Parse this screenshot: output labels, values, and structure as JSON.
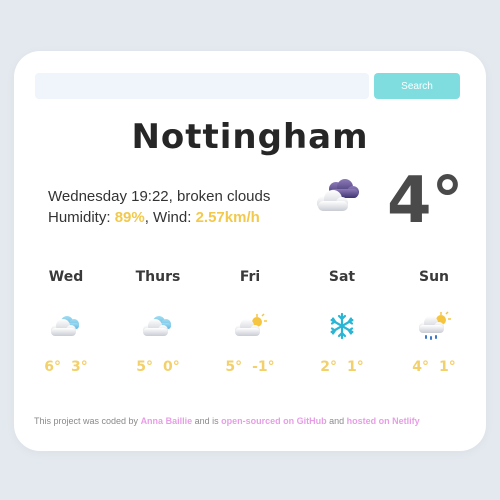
{
  "search": {
    "placeholder": "",
    "button_label": "Search"
  },
  "current": {
    "city": "Nottingham",
    "datetime_desc": "Wednesday 19:22, broken clouds",
    "humidity_label": "Humidity: ",
    "humidity_value": "89%",
    "wind_label": ", Wind: ",
    "wind_value": "2.57km/h",
    "temperature": "4°",
    "icon": "broken-clouds-night-icon"
  },
  "forecast": [
    {
      "day": "Wed",
      "high": "6°",
      "low": "3°",
      "icon": "cloud-icon"
    },
    {
      "day": "Thurs",
      "high": "5°",
      "low": "0°",
      "icon": "cloud-icon"
    },
    {
      "day": "Fri",
      "high": "5°",
      "low": "-1°",
      "icon": "partly-cloudy-icon"
    },
    {
      "day": "Sat",
      "high": "2°",
      "low": "1°",
      "icon": "snowflake-icon"
    },
    {
      "day": "Sun",
      "high": "4°",
      "low": "1°",
      "icon": "rain-sun-icon"
    }
  ],
  "footer": {
    "t1": "This project was coded by ",
    "author": "Anna Baillie",
    "t2": " and is ",
    "repo": "open-sourced on GitHub",
    "t3": " and ",
    "host": "hosted on Netlify"
  },
  "colors": {
    "accent": "#7fdde0",
    "highlight": "#f2c94c",
    "link": "#e79ee6",
    "background": "#e3e9ee"
  }
}
